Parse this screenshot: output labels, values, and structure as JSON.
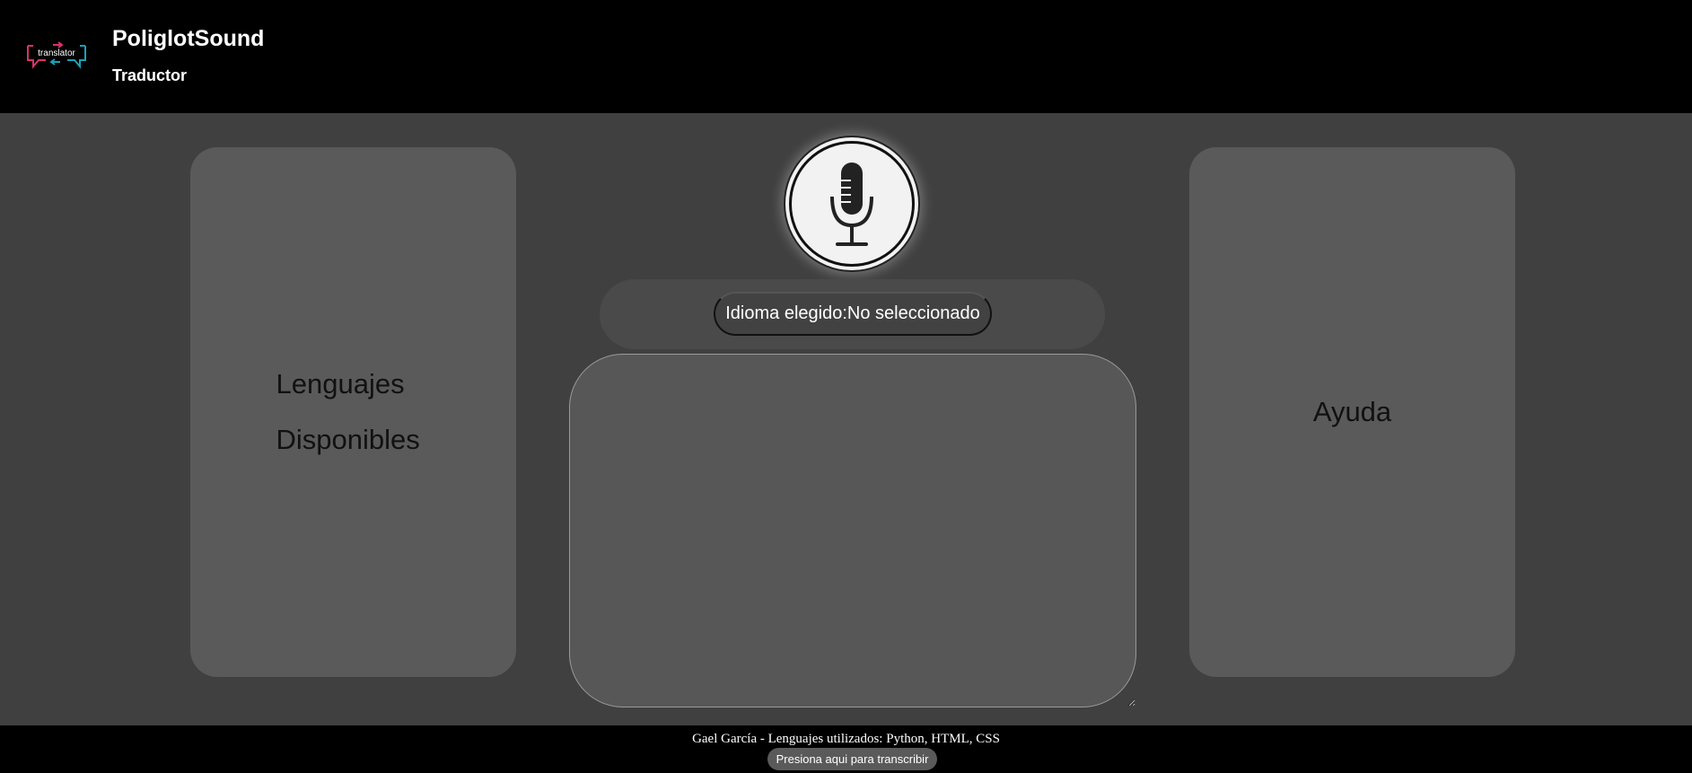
{
  "header": {
    "logo_text": "translator",
    "title": "PoliglotSound",
    "subtitle": "Traductor"
  },
  "left_panel": {
    "line1": "Lenguajes",
    "line2": "Disponibles"
  },
  "right_panel": {
    "label": "Ayuda"
  },
  "mic": {
    "icon": "microphone-icon"
  },
  "language": {
    "label": "Idioma elegido:",
    "value": "No seleccionado"
  },
  "transcript": {
    "value": ""
  },
  "footer": {
    "credit": "Gael García - Lenguajes utilizados: Python, HTML, CSS",
    "button_label": "Presiona aqui para transcribir"
  },
  "colors": {
    "header_bg": "#000000",
    "page_bg": "#404040",
    "panel_bg": "#5a5a5a",
    "logo_pink": "#d6336c",
    "logo_teal": "#17a2b8"
  }
}
